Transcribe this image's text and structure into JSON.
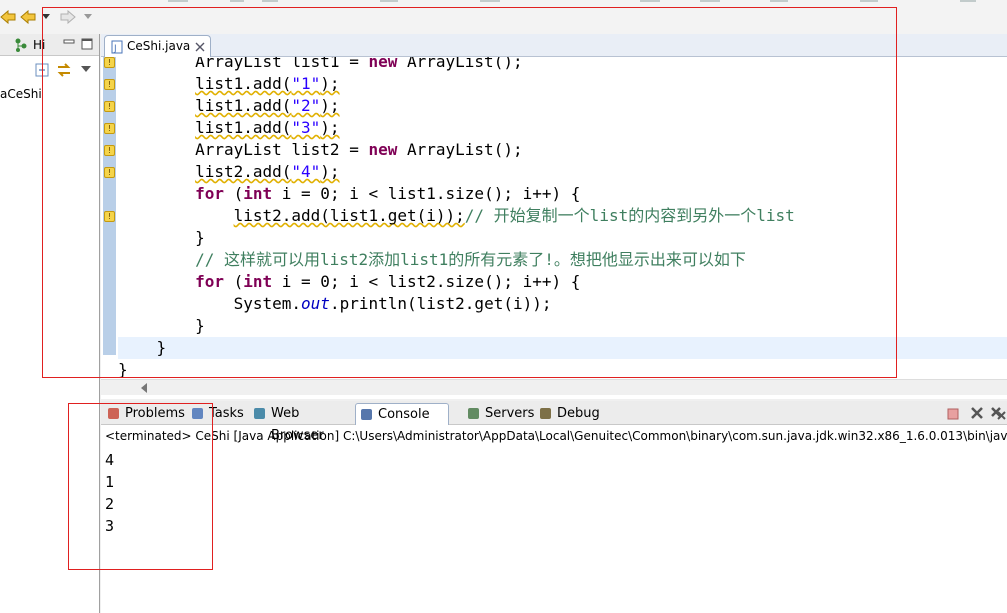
{
  "editor": {
    "tab_title": "CeShi.java",
    "code_lines": [
      {
        "parts": [
          {
            "t": "        ArrayList list1 = "
          },
          {
            "t": "new",
            "c": "kw"
          },
          {
            "t": " ArrayList();"
          }
        ]
      },
      {
        "parts": [
          {
            "t": "        "
          },
          {
            "t": "list1.add(",
            "c": "warnul"
          },
          {
            "t": "\"1\"",
            "c": "str warnul"
          },
          {
            "t": ");",
            "c": "warnul"
          }
        ]
      },
      {
        "parts": [
          {
            "t": "        "
          },
          {
            "t": "list1.add(",
            "c": "warnul"
          },
          {
            "t": "\"2\"",
            "c": "str warnul"
          },
          {
            "t": ");",
            "c": "warnul"
          }
        ]
      },
      {
        "parts": [
          {
            "t": "        "
          },
          {
            "t": "list1.add(",
            "c": "warnul"
          },
          {
            "t": "\"3\"",
            "c": "str warnul"
          },
          {
            "t": ");",
            "c": "warnul"
          }
        ]
      },
      {
        "parts": [
          {
            "t": "        ArrayList list2 = "
          },
          {
            "t": "new",
            "c": "kw"
          },
          {
            "t": " ArrayList();"
          }
        ]
      },
      {
        "parts": [
          {
            "t": "        "
          },
          {
            "t": "list2.add(",
            "c": "warnul"
          },
          {
            "t": "\"4\"",
            "c": "str warnul"
          },
          {
            "t": ");",
            "c": "warnul"
          }
        ]
      },
      {
        "parts": [
          {
            "t": "        "
          },
          {
            "t": "for",
            "c": "kw"
          },
          {
            "t": " ("
          },
          {
            "t": "int",
            "c": "kw"
          },
          {
            "t": " i = 0; i < list1.size(); i++) {"
          }
        ]
      },
      {
        "parts": [
          {
            "t": "            "
          },
          {
            "t": "list2.add(list1.get(i));",
            "c": "warnul"
          },
          {
            "t": "// 开始复制一个list的内容到另外一个list",
            "c": "cm"
          }
        ]
      },
      {
        "parts": [
          {
            "t": "        }"
          }
        ]
      },
      {
        "parts": [
          {
            "t": "        "
          },
          {
            "t": "// 这样就可以用list2添加list1的所有元素了!。想把他显示出来可以如下",
            "c": "cm"
          }
        ]
      },
      {
        "parts": [
          {
            "t": "        "
          },
          {
            "t": "for",
            "c": "kw"
          },
          {
            "t": " ("
          },
          {
            "t": "int",
            "c": "kw"
          },
          {
            "t": " i = 0; i < list2.size(); i++) {"
          }
        ]
      },
      {
        "parts": [
          {
            "t": "            System."
          },
          {
            "t": "out",
            "c": "fld"
          },
          {
            "t": ".println(list2.get(i));"
          }
        ]
      },
      {
        "parts": [
          {
            "t": "        }"
          }
        ]
      },
      {
        "parts": [
          {
            "t": "    }"
          }
        ]
      },
      {
        "parts": [
          {
            "t": "}"
          }
        ]
      }
    ]
  },
  "left_panel": {
    "tab_label": "Hi",
    "tree_item": "aCeShi"
  },
  "console": {
    "tabs": [
      {
        "label": "Problems",
        "icon": "problems-icon"
      },
      {
        "label": "Tasks",
        "icon": "tasks-icon"
      },
      {
        "label": "Web Browser",
        "icon": "web-browser-icon"
      },
      {
        "label": "Console",
        "icon": "console-icon"
      },
      {
        "label": "Servers",
        "icon": "servers-icon"
      },
      {
        "label": "Debug",
        "icon": "debug-icon"
      }
    ],
    "status": "<terminated> CeShi [Java Application] C:\\Users\\Administrator\\AppData\\Local\\Genuitec\\Common\\binary\\com.sun.java.jdk.win32.x86_1.6.0.013\\bin\\javaw.exe",
    "output": [
      "4",
      "1",
      "2",
      "3"
    ]
  },
  "colors": {
    "keyword": "#7f0055",
    "string": "#2a00ff",
    "comment": "#3f7f5f",
    "annotation_box": "#e02020"
  }
}
